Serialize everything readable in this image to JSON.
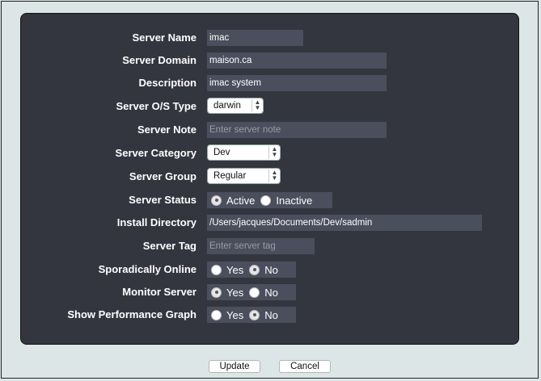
{
  "form": {
    "server_name": {
      "label": "Server Name",
      "value": "imac"
    },
    "server_domain": {
      "label": "Server Domain",
      "value": "maison.ca"
    },
    "description": {
      "label": "Description",
      "value": "imac system"
    },
    "os_type": {
      "label": "Server O/S Type",
      "value": "darwin"
    },
    "server_note": {
      "label": "Server Note",
      "value": "",
      "placeholder": "Enter server note"
    },
    "category": {
      "label": "Server Category",
      "value": "Dev"
    },
    "group": {
      "label": "Server Group",
      "value": "Regular"
    },
    "status": {
      "label": "Server Status",
      "options": [
        "Active",
        "Inactive"
      ],
      "selected": "Active"
    },
    "install_dir": {
      "label": "Install Directory",
      "value": "/Users/jacques/Documents/Dev/sadmin"
    },
    "server_tag": {
      "label": "Server Tag",
      "value": "",
      "placeholder": "Enter server tag"
    },
    "sporadically_online": {
      "label": "Sporadically Online",
      "options": [
        "Yes",
        "No"
      ],
      "selected": "No"
    },
    "monitor_server": {
      "label": "Monitor Server",
      "options": [
        "Yes",
        "No"
      ],
      "selected": "Yes"
    },
    "performance_graph": {
      "label": "Show Performance Graph",
      "options": [
        "Yes",
        "No"
      ],
      "selected": "No"
    }
  },
  "buttons": {
    "update": "Update",
    "cancel": "Cancel"
  },
  "colors": {
    "panel": "#34363f",
    "field": "#4b4e5c",
    "background": "#dde6e6"
  }
}
